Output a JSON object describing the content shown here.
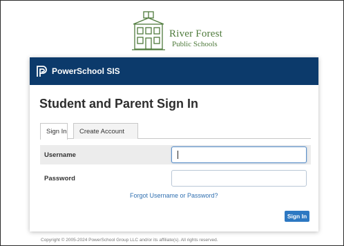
{
  "district": {
    "name": "River Forest",
    "subtitle": "Public Schools"
  },
  "header": {
    "product_name": "PowerSchool SIS",
    "brand_color": "#0c3a6b"
  },
  "page": {
    "title": "Student and Parent Sign In"
  },
  "tabs": [
    {
      "label": "Sign In",
      "active": true
    },
    {
      "label": "Create Account",
      "active": false
    }
  ],
  "form": {
    "username_label": "Username",
    "username_value": "",
    "password_label": "Password",
    "password_value": "",
    "forgot_link": "Forgot Username or Password?",
    "submit_label": "Sign In"
  },
  "footer": {
    "copyright": "Copyright © 2005-2024 PowerSchool Group LLC and/or its affiliate(s). All rights reserved."
  }
}
